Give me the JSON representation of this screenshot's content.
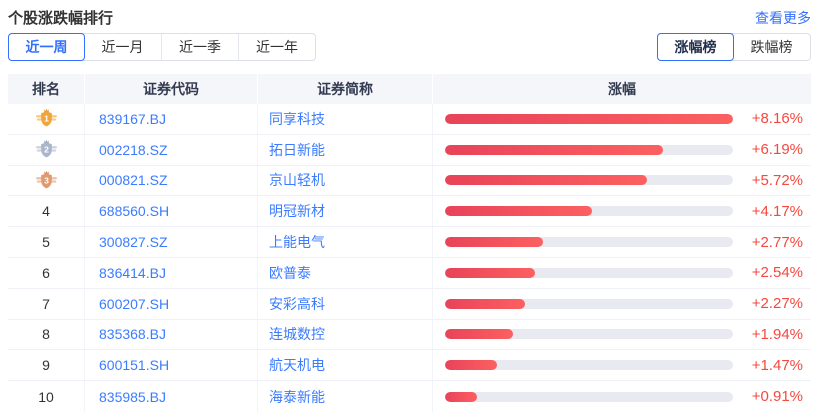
{
  "header": {
    "title": "个股涨跌幅排行",
    "more_label": "查看更多"
  },
  "period_tabs": {
    "items": [
      {
        "label": "近一周",
        "active": true
      },
      {
        "label": "近一月",
        "active": false
      },
      {
        "label": "近一季",
        "active": false
      },
      {
        "label": "近一年",
        "active": false
      }
    ]
  },
  "board_tabs": {
    "items": [
      {
        "label": "涨幅榜",
        "active": true
      },
      {
        "label": "跌幅榜",
        "active": false
      }
    ]
  },
  "table": {
    "columns": [
      "排名",
      "证券代码",
      "证券简称",
      "涨幅"
    ],
    "max_change_pct": 8.16,
    "rows": [
      {
        "rank": 1,
        "medal": "gold",
        "code": "839167.BJ",
        "name": "同享科技",
        "change_label": "+8.16%",
        "change_pct": 8.16
      },
      {
        "rank": 2,
        "medal": "silver",
        "code": "002218.SZ",
        "name": "拓日新能",
        "change_label": "+6.19%",
        "change_pct": 6.19
      },
      {
        "rank": 3,
        "medal": "bronze",
        "code": "000821.SZ",
        "name": "京山轻机",
        "change_label": "+5.72%",
        "change_pct": 5.72
      },
      {
        "rank": 4,
        "medal": null,
        "code": "688560.SH",
        "name": "明冠新材",
        "change_label": "+4.17%",
        "change_pct": 4.17
      },
      {
        "rank": 5,
        "medal": null,
        "code": "300827.SZ",
        "name": "上能电气",
        "change_label": "+2.77%",
        "change_pct": 2.77
      },
      {
        "rank": 6,
        "medal": null,
        "code": "836414.BJ",
        "name": "欧普泰",
        "change_label": "+2.54%",
        "change_pct": 2.54
      },
      {
        "rank": 7,
        "medal": null,
        "code": "600207.SH",
        "name": "安彩高科",
        "change_label": "+2.27%",
        "change_pct": 2.27
      },
      {
        "rank": 8,
        "medal": null,
        "code": "835368.BJ",
        "name": "连城数控",
        "change_label": "+1.94%",
        "change_pct": 1.94
      },
      {
        "rank": 9,
        "medal": null,
        "code": "600151.SH",
        "name": "航天机电",
        "change_label": "+1.47%",
        "change_pct": 1.47
      },
      {
        "rank": 10,
        "medal": null,
        "code": "835985.BJ",
        "name": "海泰新能",
        "change_label": "+0.91%",
        "change_pct": 0.91
      }
    ]
  },
  "colors": {
    "accent_blue": "#3370fe",
    "up_red": "#f5483f",
    "bar_gradient_start": "#e8435a",
    "bar_gradient_end": "#fc6060",
    "bar_track": "#e9e9f1",
    "header_bg": "#f5f6fa",
    "medals": {
      "gold": {
        "body": "#f0a43c",
        "wing": "#f6ca82",
        "crown": "#e8952f"
      },
      "silver": {
        "body": "#a9b6cb",
        "wing": "#ccd4e0",
        "crown": "#9aa9c0"
      },
      "bronze": {
        "body": "#e09a72",
        "wing": "#eec3a5",
        "crown": "#d68b60"
      }
    }
  }
}
